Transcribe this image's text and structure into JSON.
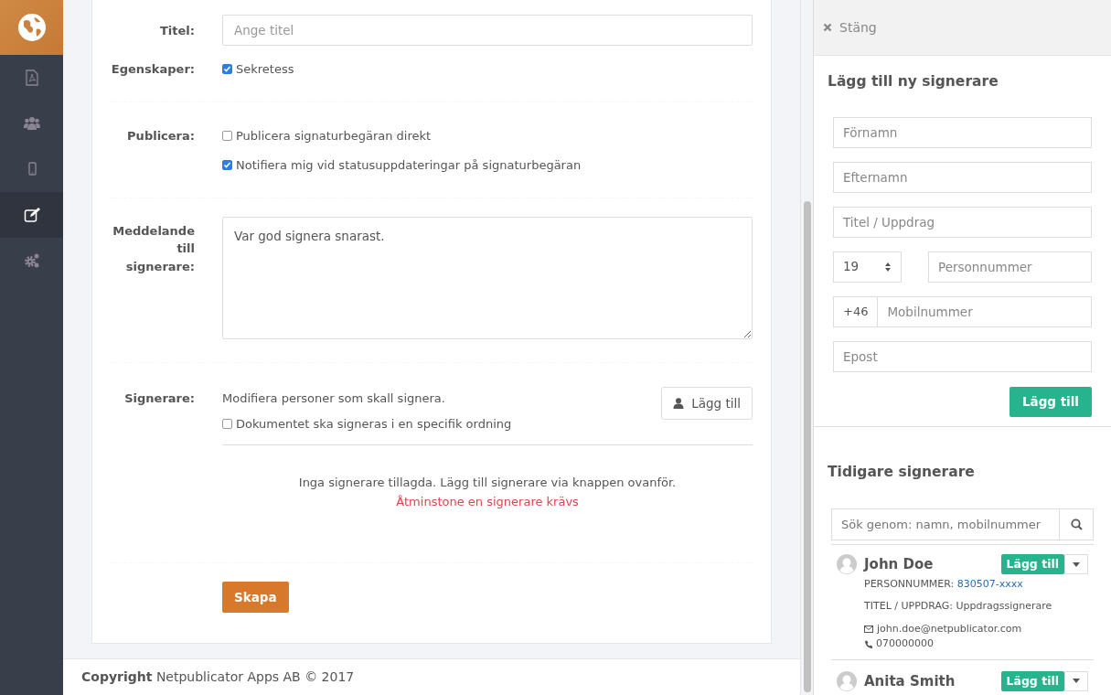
{
  "sidebar": {
    "items": [
      {
        "kind": "pdf",
        "selected": false
      },
      {
        "kind": "users",
        "selected": false
      },
      {
        "kind": "mobile",
        "selected": false
      },
      {
        "kind": "edit",
        "selected": true
      },
      {
        "kind": "cogs",
        "selected": false
      }
    ]
  },
  "form": {
    "title": {
      "label": "Titel:",
      "placeholder": "Ange titel"
    },
    "properties": {
      "label": "Egenskaper:",
      "options": [
        {
          "label": "Sekretess",
          "checked": true
        }
      ]
    },
    "publish": {
      "label": "Publicera:",
      "options": [
        {
          "label": "Publicera signaturbegäran direkt",
          "checked": false
        },
        {
          "label": "Notifiera mig vid statusuppdateringar på signaturbegäran",
          "checked": true
        }
      ]
    },
    "message": {
      "label": "Meddelande till signerare:",
      "value": "Var god signera snarast."
    },
    "signers": {
      "label": "Signerare:",
      "description": "Modifiera personer som skall signera.",
      "order_option": {
        "label": "Dokumentet ska signeras i en specifik ordning",
        "checked": false
      },
      "add_button": "Lägg till",
      "empty_text": "Inga signerare tillagda. Lägg till signerare via knappen ovanför.",
      "required_text": "Åtminstone en signerare krävs"
    },
    "submit": "Skapa"
  },
  "footer": {
    "text": "**Copyright** Netpublicator Apps AB © 2017"
  },
  "panel": {
    "close": "Stäng",
    "new_signer": {
      "heading": "Lägg till ny signerare",
      "first_name": {
        "placeholder": "Förnamn"
      },
      "last_name": {
        "placeholder": "Efternamn"
      },
      "title": {
        "placeholder": "Titel / Uppdrag"
      },
      "century": {
        "value": "19"
      },
      "personal_number": {
        "placeholder": "Personnummer"
      },
      "country_code": "+46",
      "mobile": {
        "placeholder": "Mobilnummer"
      },
      "email": {
        "placeholder": "Epost"
      },
      "button": "Lägg till"
    },
    "previous": {
      "heading": "Tidigare signerare",
      "search": {
        "placeholder": "Sök genom: namn, mobilnummer"
      },
      "signers": [
        {
          "name": "John Doe",
          "button": "Lägg till",
          "personnummer_label": "PERSONNUMMER:",
          "personnummer": "830507-xxxx",
          "title": "TITEL / UPPDRAG: Uppdragssignerare",
          "email": "john.doe@netpublicator.com",
          "phone": "070000000"
        },
        {
          "name": "Anita Smith",
          "button": "Lägg till"
        }
      ]
    }
  }
}
